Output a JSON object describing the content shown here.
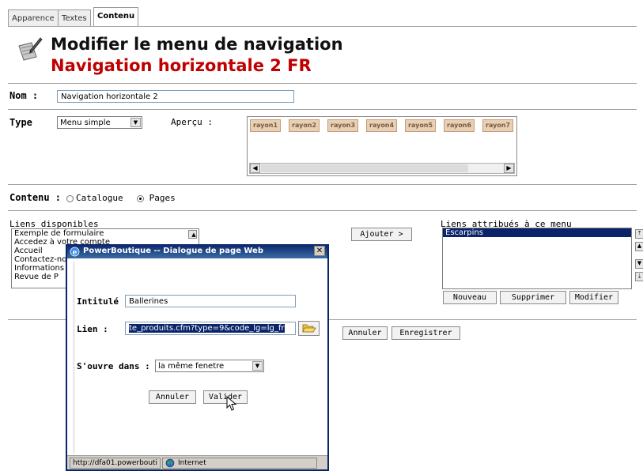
{
  "tabs": [
    "Apparence",
    "Textes",
    "Contenu"
  ],
  "header": {
    "title": "Modifier le menu de navigation",
    "subtitle": "Navigation horizontale 2 FR"
  },
  "form": {
    "nom_label": "Nom :",
    "nom_value": "Navigation horizontale 2",
    "type_label": "Type",
    "type_value": "Menu simple",
    "apercu_label": "Aperçu :",
    "rayons": [
      "rayon1",
      "rayon2",
      "rayon3",
      "rayon4",
      "rayon5",
      "rayon6",
      "rayon7"
    ],
    "contenu_label": "Contenu :",
    "radio_catalogue": "Catalogue",
    "radio_pages": "Pages",
    "selected_contenu": "Pages"
  },
  "liens_disponibles": {
    "label": "Liens disponibles",
    "items": [
      "Exemple de formulaire",
      "Accedez à votre compte",
      "Accueil",
      "Contactez-nous",
      "Informations",
      "Revue de P"
    ]
  },
  "ajouter_label": "Ajouter >",
  "liens_attribues": {
    "label": "Liens attribués à ce menu",
    "items": [
      "Escarpins"
    ],
    "nouveau": "Nouveau",
    "supprimer": "Supprimer",
    "modifier": "Modifier"
  },
  "bottom": {
    "annuler": "Annuler",
    "enregistrer": "Enregistrer"
  },
  "dialog": {
    "title": "PowerBoutique -- Dialogue de page Web",
    "close": "✕",
    "intitule_label": "Intitulé :",
    "intitule_value": "Ballerines",
    "lien_label": "Lien :",
    "lien_value": "te_produits.cfm?type=9&code_lg=lg_fr",
    "ouvre_label": "S'ouvre dans :",
    "ouvre_value": "la même fenetre",
    "annuler": "Annuler",
    "valider": "Valider",
    "status_url": "http://dfa01.powerbouti",
    "status_zone": "Internet"
  }
}
